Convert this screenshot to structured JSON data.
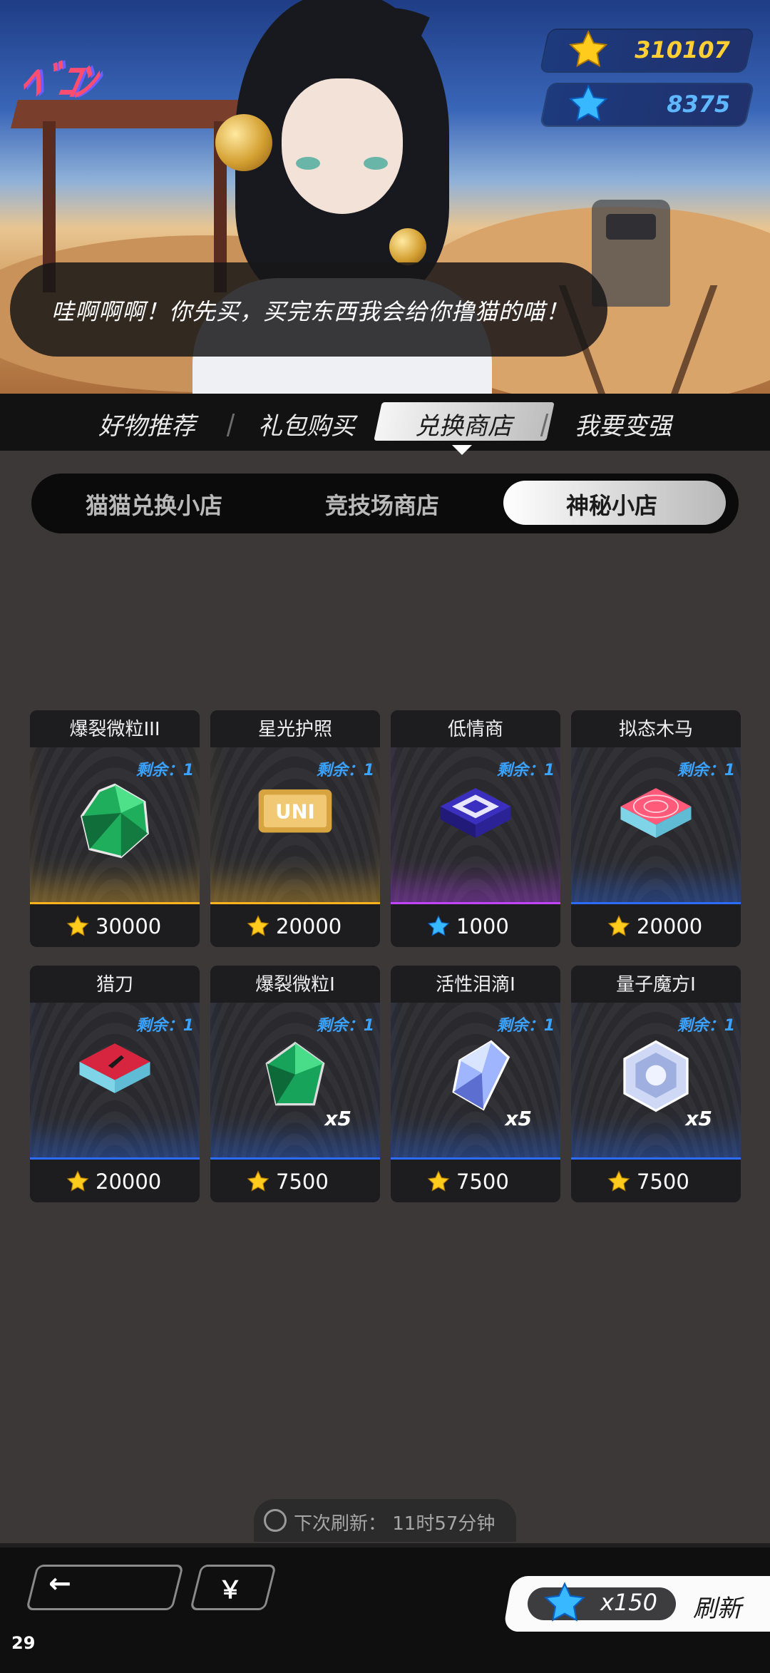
{
  "currency": {
    "gold": "310107",
    "blue": "8375"
  },
  "speech": "哇啊啊啊！你先买，买完东西我会给你撸猫的喵！",
  "main_tabs": [
    "好物推荐",
    "礼包购买",
    "兑换商店",
    "我要变强"
  ],
  "sub_tabs": [
    "猫猫兑换小店",
    "竞技场商店",
    "神秘小店"
  ],
  "items": [
    {
      "name": "爆裂微粒III",
      "remain": "剩余：1",
      "price": "30000",
      "currency": "gold",
      "rarity": "gold",
      "icon": "green-crystal-icon"
    },
    {
      "name": "星光护照",
      "remain": "剩余：1",
      "price": "20000",
      "currency": "gold",
      "rarity": "gold",
      "icon": "passport-card-icon"
    },
    {
      "name": "低情商",
      "remain": "剩余：1",
      "price": "1000",
      "currency": "blue",
      "rarity": "purple",
      "icon": "purple-chip-icon"
    },
    {
      "name": "拟态木马",
      "remain": "剩余：1",
      "price": "20000",
      "currency": "gold",
      "rarity": "blue",
      "icon": "red-chip-icon"
    },
    {
      "name": "猎刀",
      "remain": "剩余：1",
      "price": "20000",
      "currency": "gold",
      "rarity": "blue",
      "icon": "knife-chip-icon"
    },
    {
      "name": "爆裂微粒I",
      "remain": "剩余：1",
      "price": "7500",
      "currency": "gold",
      "rarity": "blue",
      "icon": "small-green-gem-icon",
      "mult": "x5"
    },
    {
      "name": "活性泪滴I",
      "remain": "剩余：1",
      "price": "7500",
      "currency": "gold",
      "rarity": "blue",
      "icon": "tear-crystal-icon",
      "mult": "x5"
    },
    {
      "name": "量子魔方I",
      "remain": "剩余：1",
      "price": "7500",
      "currency": "gold",
      "rarity": "blue",
      "icon": "quantum-cube-icon",
      "mult": "x5"
    }
  ],
  "refresh_timer": "下次刷新：  11时57分钟",
  "bottom": {
    "back": "←",
    "yen": "￥",
    "refresh_cost": "x150",
    "refresh_label": "刷新"
  },
  "fps": "29",
  "colors": {
    "gold": "#ffcf33",
    "blue": "#3aa2ff",
    "purple": "#c244ff"
  }
}
